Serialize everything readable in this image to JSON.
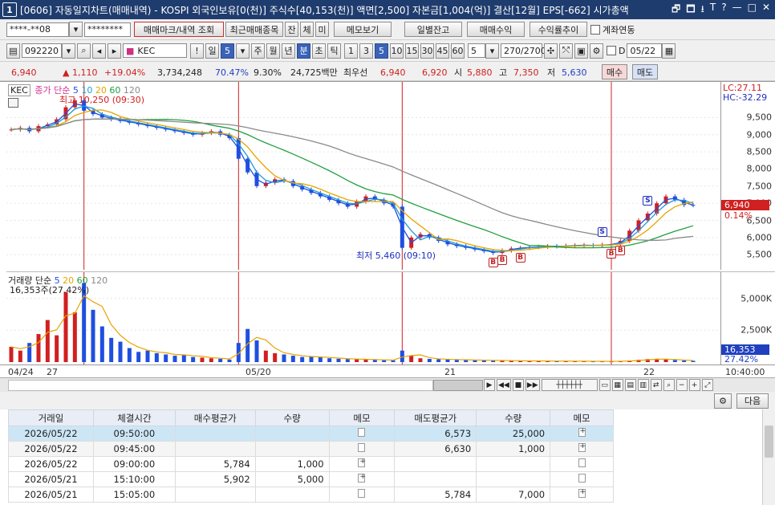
{
  "title": {
    "screen_num": "1",
    "text": "[0606] 자동일지차트(매매내역) - KOSPI 외국인보유[0(천)] 주식수[40,153(천)] 액면[2,500] 자본금[1,004(억)] 결산[12월] EPS[-662] 시가총액",
    "controls": [
      "🗗",
      "🗖",
      "⭳",
      "T",
      "?",
      "—",
      "□",
      "✕"
    ]
  },
  "toolbar1": {
    "account": "****-**08",
    "password": "********",
    "btn_trade_mark": "매매마크/내역 조회",
    "btn_recent": "최근매매종목",
    "tab1": "잔",
    "tab2": "체",
    "tab3": "미",
    "btn_memo": "메모보기",
    "btn_daily": "일별잔고",
    "btn_profit": "매매수익",
    "btn_yield": "수익률추이",
    "chk_account_link": "계좌연동"
  },
  "toolbar2": {
    "code": "092220",
    "name": "KEC",
    "excl": "!",
    "day_label": "일",
    "period_value": "5",
    "periods": [
      "주",
      "월",
      "년",
      "분",
      "초",
      "틱"
    ],
    "intervals": [
      "1",
      "3",
      "5",
      "10",
      "15",
      "30",
      "45",
      "60"
    ],
    "interval_selected": "5",
    "count_value": "5",
    "count_display": "270/2700",
    "d_label": "D",
    "date": "05/22"
  },
  "quote": {
    "price": "6,940",
    "change": "▲ 1,110",
    "change_pct": "+19.04%",
    "volume": "3,734,248",
    "ratio1": "70.47%",
    "ratio2": "9.30%",
    "amount": "24,725백만",
    "priority": "최우선",
    "ask": "6,940",
    "bid": "6,920",
    "open_label": "시",
    "open": "5,880",
    "high_label": "고",
    "high": "7,350",
    "low_label": "저",
    "low": "5,630",
    "btn_buy": "매수",
    "btn_sell": "매도"
  },
  "chart_data": {
    "type": "line",
    "title": "",
    "symbol": "KEC",
    "ma_legend": {
      "label": "종가 단순",
      "periods": [
        "5",
        "10",
        "20",
        "60",
        "120"
      ],
      "colors": [
        "#1f4fe0",
        "#1f9ad0",
        "#e6a400",
        "#20a040",
        "#8a8a8a"
      ]
    },
    "annotations": {
      "high_text": "최고 10,250 (09:30)",
      "low_text": "최저 5,460 (09:10)",
      "lc": "LC:27.11",
      "hc": "HC:-32.29",
      "last_price": "6,940",
      "last_pct": "0.14%"
    },
    "ylim": [
      5200,
      10400
    ],
    "yticks": [
      "9,500",
      "9,000",
      "8,500",
      "8,000",
      "7,500",
      "7,000",
      "6,500",
      "6,000",
      "5,500"
    ],
    "ytick_values": [
      9500,
      9000,
      8500,
      8000,
      7500,
      7000,
      6500,
      6000,
      5500
    ],
    "close": [
      9150,
      9200,
      9100,
      9250,
      9300,
      9450,
      9800,
      10000,
      9700,
      9600,
      9500,
      9450,
      9400,
      9350,
      9300,
      9250,
      9200,
      9150,
      9100,
      9050,
      9000,
      9050,
      9100,
      9000,
      8900,
      8300,
      7900,
      7500,
      7600,
      7700,
      7650,
      7500,
      7400,
      7300,
      7200,
      7100,
      7000,
      6900,
      7050,
      7200,
      7100,
      7000,
      6900,
      5700,
      6000,
      6100,
      6000,
      5900,
      5800,
      5750,
      5700,
      5650,
      5600,
      5550,
      5620,
      5680,
      5700,
      5720,
      5730,
      5750,
      5740,
      5760,
      5770,
      5780,
      5760,
      5790,
      5800,
      5900,
      6200,
      6500,
      6700,
      7000,
      7200,
      7100,
      6950,
      6940
    ],
    "markers": [
      {
        "type": "B",
        "i": 53
      },
      {
        "type": "B",
        "i": 54
      },
      {
        "type": "B",
        "i": 56
      },
      {
        "type": "S",
        "i": 65
      },
      {
        "type": "B",
        "i": 66
      },
      {
        "type": "B",
        "i": 67
      },
      {
        "type": "S",
        "i": 70
      }
    ],
    "volume": {
      "label": "거래량 단순",
      "periods": [
        "5",
        "20",
        "60",
        "120"
      ],
      "info": "16,353주(27.42%)",
      "yticks": [
        "5,000K",
        "2,500K"
      ],
      "ytick_values": [
        5000,
        2500
      ],
      "ylim": [
        0,
        6800
      ],
      "current": "16,353",
      "current_pct": "27.42%",
      "values": [
        1200,
        900,
        1500,
        2200,
        3300,
        2100,
        5500,
        3900,
        6200,
        4100,
        2800,
        1900,
        1600,
        1100,
        800,
        900,
        700,
        600,
        500,
        600,
        400,
        350,
        300,
        250,
        200,
        1500,
        2600,
        1700,
        900,
        700,
        600,
        500,
        400,
        420,
        380,
        300,
        260,
        240,
        220,
        200,
        180,
        150,
        140,
        900,
        500,
        300,
        250,
        220,
        200,
        180,
        160,
        150,
        140,
        120,
        120,
        100,
        100,
        90,
        90,
        80,
        80,
        70,
        70,
        70,
        60,
        60,
        60,
        80,
        120,
        180,
        240,
        260,
        200,
        160,
        120,
        100
      ]
    },
    "xticks": [
      "04/24",
      "27",
      "05/20",
      "21",
      "22",
      "10:40:00"
    ]
  },
  "table": {
    "headers": [
      "거래일",
      "체결시간",
      "매수평균가",
      "수량",
      "메모",
      "매도평균가",
      "수량",
      "메모"
    ],
    "rows": [
      [
        "2026/05/22",
        "09:50:00",
        "",
        "",
        "",
        "6,573",
        "25,000",
        ""
      ],
      [
        "2026/05/22",
        "09:45:00",
        "",
        "",
        "",
        "6,630",
        "1,000",
        ""
      ],
      [
        "2026/05/22",
        "09:00:00",
        "5,784",
        "1,000",
        "",
        "",
        "",
        ""
      ],
      [
        "2026/05/21",
        "15:10:00",
        "5,902",
        "5,000",
        "",
        "",
        "",
        ""
      ],
      [
        "2026/05/21",
        "15:05:00",
        "",
        "",
        "",
        "5,784",
        "7,000",
        ""
      ]
    ]
  },
  "bottom": {
    "btn_next": "다음",
    "btn_settings": "⚙"
  }
}
